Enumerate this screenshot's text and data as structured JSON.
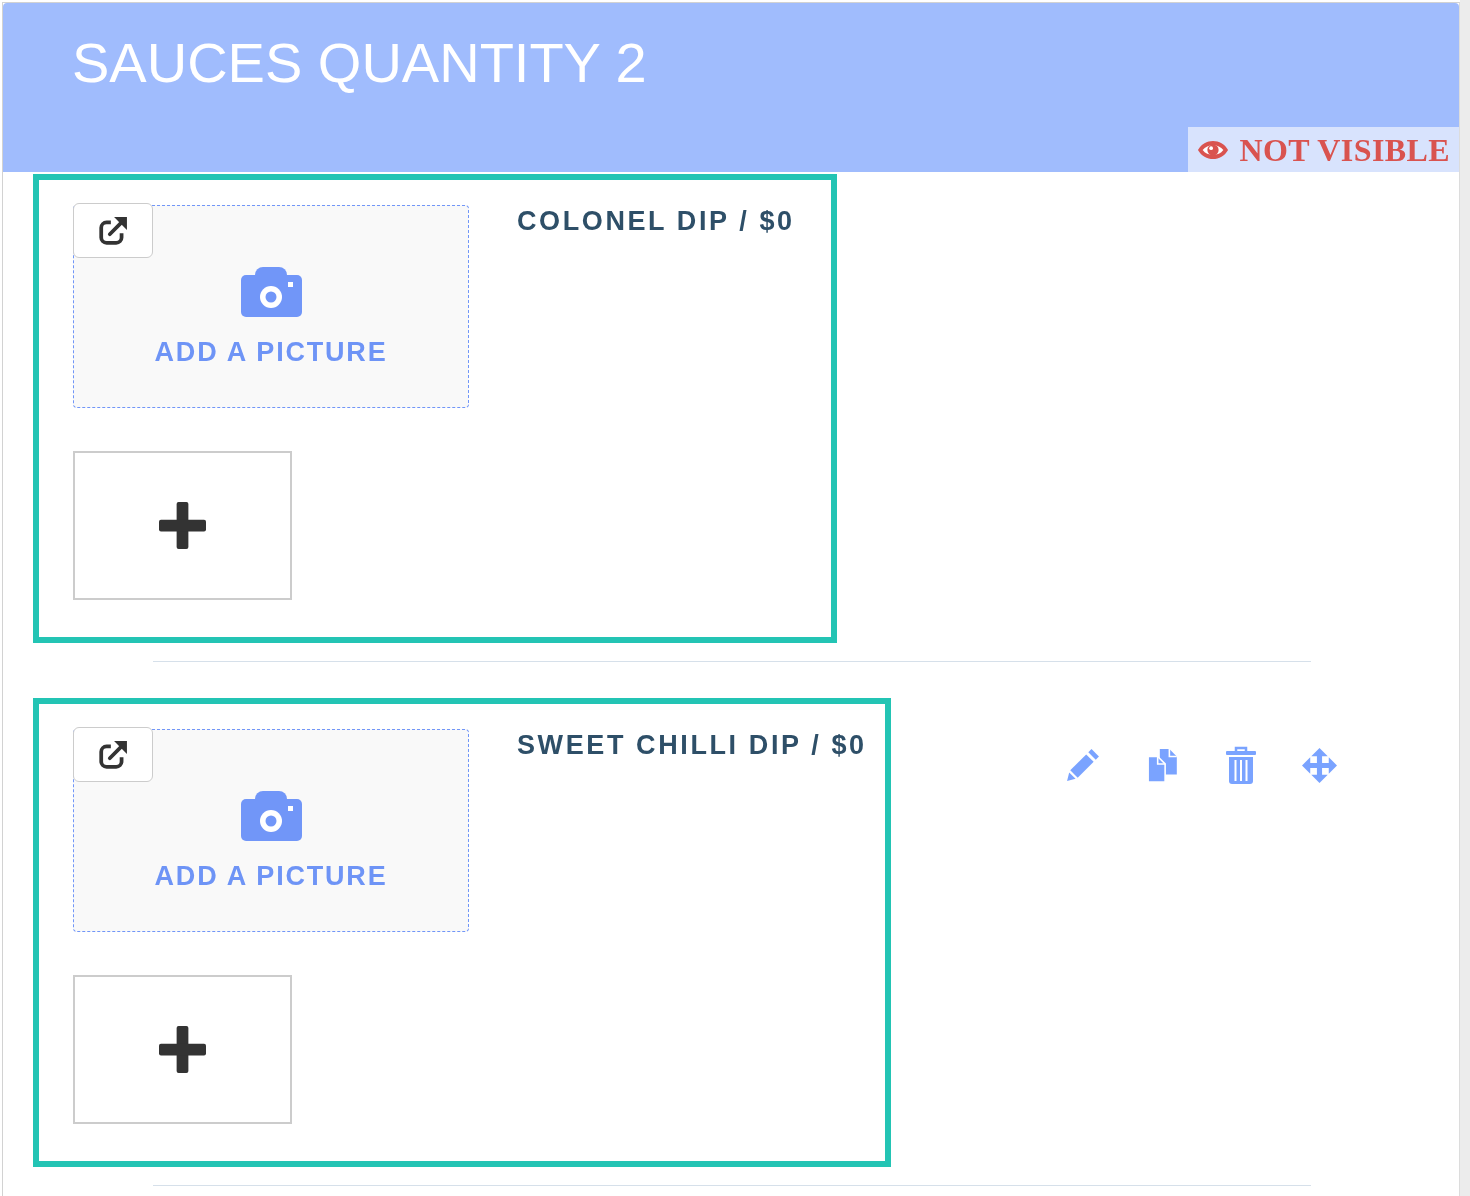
{
  "header": {
    "title": "SAUCES QUANTITY 2",
    "visibility_badge": "NOT VISIBLE"
  },
  "items": [
    {
      "title": "COLONEL DIP / $0",
      "picture_label": "ADD A PICTURE",
      "selected": true,
      "actions_shown": false
    },
    {
      "title": "SWEET CHILLI DIP / $0",
      "picture_label": "ADD A PICTURE",
      "selected": true,
      "actions_shown": true
    }
  ]
}
